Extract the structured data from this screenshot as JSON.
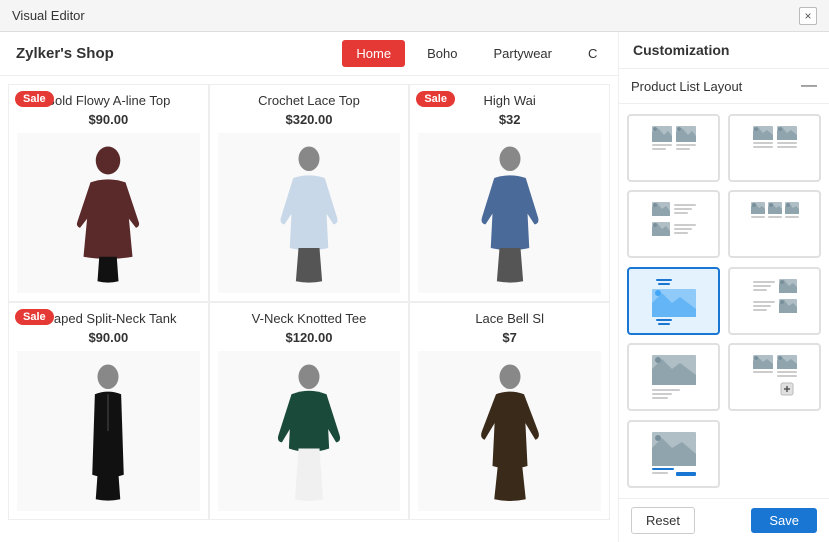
{
  "titleBar": {
    "title": "Visual Editor",
    "closeLabel": "×"
  },
  "shopName": "Zylker's Shop",
  "nav": {
    "home": "Home",
    "boho": "Boho",
    "partywear": "Partywear",
    "more": "C"
  },
  "products": [
    {
      "name": "Bold Flowy A-line Top",
      "price": "$90.00",
      "sale": true,
      "color": "#5a2a2a"
    },
    {
      "name": "Crochet Lace Top",
      "price": "$320.00",
      "sale": false,
      "color": "#c8d8e8"
    },
    {
      "name": "High Wai",
      "price": "$32",
      "sale": true,
      "color": "#c8d8e8",
      "partial": true
    },
    {
      "name": "Draped Split-Neck Tank",
      "price": "$90.00",
      "sale": true,
      "color": "#1a1a1a"
    },
    {
      "name": "V-Neck Knotted Tee",
      "price": "$120.00",
      "sale": false,
      "color": "#1a4a3a"
    },
    {
      "name": "Lace Bell Sl",
      "price": "$7",
      "sale": false,
      "color": "#3a2a1a",
      "partial": true
    }
  ],
  "panel": {
    "header": "Customization",
    "sectionTitle": "Product List Layout",
    "collapseLabel": "—"
  },
  "footer": {
    "resetLabel": "Reset",
    "saveLabel": "Save"
  }
}
